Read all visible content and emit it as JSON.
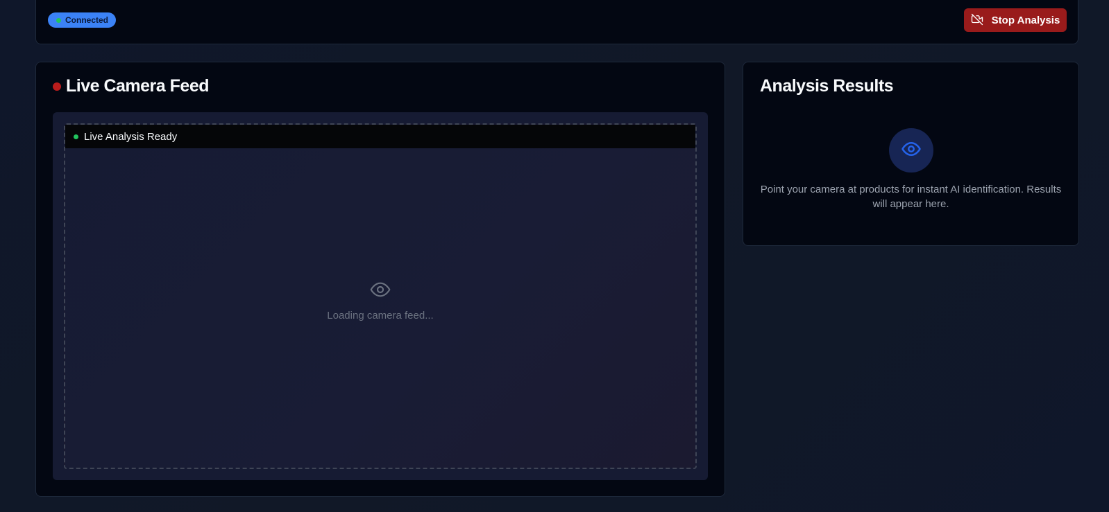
{
  "topbar": {
    "status_label": "Connected",
    "stop_button_label": "Stop Analysis",
    "stop_icon": "video-off-icon"
  },
  "camera": {
    "title": "Live Camera Feed",
    "ready_label": "Live Analysis Ready",
    "loading_label": "Loading camera feed...",
    "loading_icon": "eye-icon"
  },
  "results": {
    "title": "Analysis Results",
    "hint": "Point your camera at products for instant AI identification. Results will appear here.",
    "icon": "eye-icon"
  },
  "colors": {
    "accent": "#3b82f6",
    "danger": "#991b1b",
    "live_dot": "#b91c1c",
    "ok": "#22c55e"
  }
}
